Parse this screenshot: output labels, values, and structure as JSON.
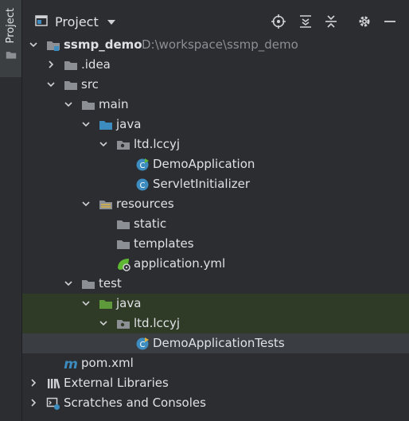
{
  "stripe": {
    "label": "Project"
  },
  "header": {
    "title": "Project"
  },
  "tree": {
    "root": {
      "name": "ssmp_demo",
      "path": "D:\\workspace\\ssmp_demo"
    },
    "idea": ".idea",
    "src": "src",
    "main": "main",
    "main_java": "java",
    "main_pkg": "ltd.lccyj",
    "demo_app": "DemoApplication",
    "servlet_init": "ServletInitializer",
    "resources": "resources",
    "static": "static",
    "templates": "templates",
    "app_yml": "application.yml",
    "test": "test",
    "test_java": "java",
    "test_pkg": "ltd.lccyj",
    "demo_tests": "DemoApplicationTests",
    "pom": "pom.xml",
    "ext_libs": "External Libraries",
    "scratches": "Scratches and Consoles"
  },
  "colors": {
    "background": "#2b2d30",
    "folder": "#8c8f94",
    "source_folder": "#3d8cbf",
    "test_folder": "#5e9a3c",
    "class": "#3d8cbf",
    "test_row_bg": "#2f3a27",
    "selected_row_bg": "#3a3d41"
  }
}
